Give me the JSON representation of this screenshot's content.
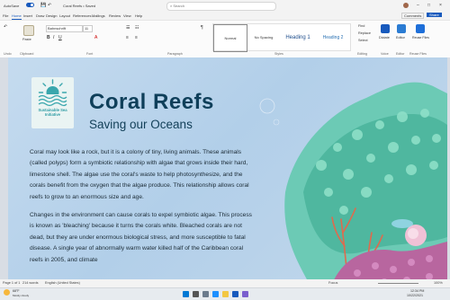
{
  "titlebar": {
    "autosave": "AutoSave",
    "toggle": "On",
    "doc_title": "Coral Reefs • Saved",
    "search_placeholder": "Search"
  },
  "menu": {
    "tabs": [
      "File",
      "Home",
      "Insert",
      "Draw",
      "Design",
      "Layout",
      "References",
      "Mailings",
      "Review",
      "View",
      "Help"
    ],
    "active": "Home",
    "right": [
      "Comments",
      "Share"
    ]
  },
  "ribbon": {
    "font_name": "Bahnschrift",
    "font_size": "11",
    "groups": [
      "Undo",
      "Clipboard",
      "Font",
      "Paragraph",
      "Styles",
      "Editing",
      "Voice",
      "Editor",
      "Reuse Files"
    ],
    "styles": [
      {
        "label": "Normal"
      },
      {
        "label": "No Spacing"
      },
      {
        "label": "Heading 1"
      },
      {
        "label": "Heading 2"
      }
    ],
    "editing": [
      "Find",
      "Replace",
      "Select"
    ],
    "big_buttons": [
      "Dictate",
      "Editor",
      "Reuse Files"
    ],
    "paste": "Paste",
    "accent": "#185abd"
  },
  "document": {
    "logo": "Sustainable Sea Initiative",
    "title": "Coral Reefs",
    "subtitle": "Saving our Oceans",
    "paragraphs": [
      "Coral may look like a rock, but it is a colony of tiny, living animals. These animals (called polyps) form a symbiotic relationship with algae that grows inside their hard, limestone shell. The algae use the coral's waste to help photosynthesize, and the corals benefit from the oxygen that the algae produce. This relationship allows coral reefs to grow to an enormous size and age.",
      "Changes in the environment can cause corals to expel symbiotic algae. This process is known as 'bleaching' because it turns the corals white. Bleached corals are not dead, but they are under enormous biological stress, and more susceptible to fatal disease. A single year of abnormally warm water killed half of the Caribbean coral reefs in 2005, and climate"
    ]
  },
  "status": {
    "page": "Page 1 of 1",
    "words": "214 words",
    "language": "English (United States)",
    "focus": "Focus",
    "zoom": "100%"
  },
  "taskbar": {
    "weather_temp": "68°F",
    "weather_desc": "Mostly cloudy",
    "time": "12:34 PM",
    "date": "10/22/2021"
  }
}
